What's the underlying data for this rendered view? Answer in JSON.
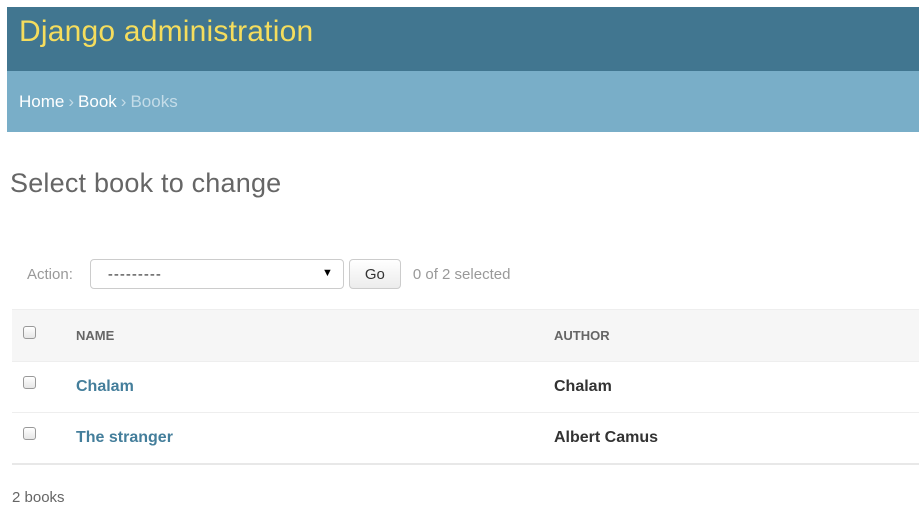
{
  "header": {
    "branding": "Django administration"
  },
  "breadcrumbs": {
    "home": "Home",
    "app": "Book",
    "current": "Books",
    "separator": "›"
  },
  "content": {
    "title": "Select book to change"
  },
  "actions": {
    "label": "Action:",
    "selected_option": "---------",
    "go_label": "Go",
    "selection_count": "0 of 2 selected"
  },
  "results": {
    "columns": [
      "NAME",
      "AUTHOR"
    ],
    "rows": [
      {
        "name": "Chalam",
        "author": "Chalam"
      },
      {
        "name": "The stranger",
        "author": "Albert Camus"
      }
    ]
  },
  "paginator": {
    "text": "2 books"
  },
  "colors": {
    "header_bg": "#417690",
    "branding": "#f5dd5d",
    "breadcrumbs_bg": "#79aec8",
    "link": "#447e9b"
  }
}
